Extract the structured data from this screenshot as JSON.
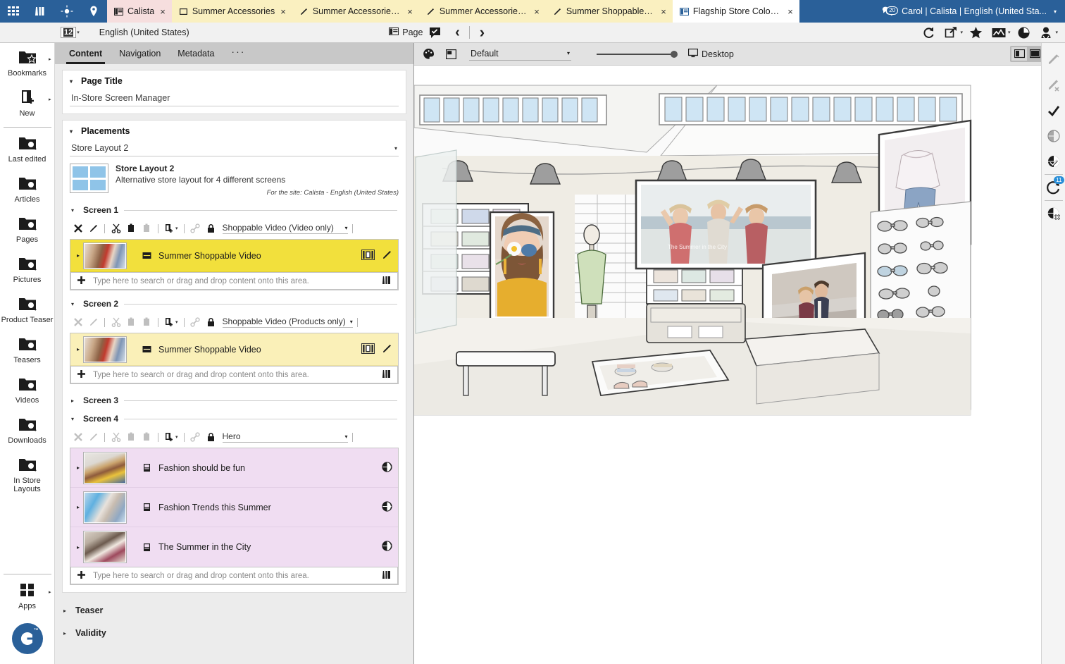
{
  "topbar": {
    "apps_icon": "grid-apps-icon",
    "library_icon": "library-icon",
    "target_icon": "target-icon",
    "location_icon": "location-pin-icon",
    "tabs": [
      {
        "label": "Calista",
        "icon": "site-icon",
        "color": "pink",
        "close": "×"
      },
      {
        "label": "Summer Accessories",
        "icon": "page-icon",
        "color": "yellow",
        "close": "×"
      },
      {
        "label": "Summer Accessories Im...",
        "icon": "edit-icon",
        "color": "yellow",
        "close": "×"
      },
      {
        "label": "Summer Accessories Im...",
        "icon": "edit-icon",
        "color": "yellow",
        "close": "×"
      },
      {
        "label": "Summer Shoppable Video",
        "icon": "edit-icon",
        "color": "yellow",
        "close": "×"
      },
      {
        "label": "Flagship Store Cologne -...",
        "icon": "site-icon",
        "color": "white",
        "close": "×"
      }
    ],
    "notification_icon": "notifications-icon",
    "notification_count": "20",
    "user": "Carol | Calista | English (United Sta...",
    "user_caret": "▾"
  },
  "toolbar2": {
    "page_number": "12",
    "page_number_caret": "▾",
    "language": "English (United States)",
    "page_button_label": "Page",
    "page_button_icon": "page-icon",
    "approve_icon": "approved-comment-icon",
    "prev_icon": "‹",
    "next_icon": "›",
    "reload_icon": "reload-icon",
    "open_in_new_icon": "open-in-new-icon",
    "favorite_icon": "star-icon",
    "image_icon": "image-icon",
    "timing_icon": "time-icon",
    "user_icon": "user-icon"
  },
  "leftrail": {
    "items": [
      {
        "label": "Bookmarks",
        "icon": "folder-star-icon",
        "arrow": "▸"
      },
      {
        "label": "New",
        "icon": "new-document-icon",
        "arrow": "▸"
      },
      {
        "label": "Last edited",
        "icon": "folder-search-icon"
      },
      {
        "label": "Articles",
        "icon": "folder-search-icon"
      },
      {
        "label": "Pages",
        "icon": "folder-search-icon"
      },
      {
        "label": "Pictures",
        "icon": "folder-search-icon"
      },
      {
        "label": "Product Teaser",
        "icon": "folder-search-icon"
      },
      {
        "label": "Teasers",
        "icon": "folder-search-icon"
      },
      {
        "label": "Videos",
        "icon": "folder-search-icon"
      },
      {
        "label": "Downloads",
        "icon": "folder-search-icon"
      },
      {
        "label": "In Store Layouts",
        "icon": "folder-search-icon"
      }
    ],
    "apps": {
      "label": "Apps",
      "icon": "apps-grid-icon",
      "arrow": "▸"
    },
    "logo": {
      "name": "coremedia-logo",
      "text": "C",
      "tm": "™"
    }
  },
  "form": {
    "tabs": [
      {
        "label": "Content",
        "active": true
      },
      {
        "label": "Navigation",
        "active": false
      },
      {
        "label": "Metadata",
        "active": false
      },
      {
        "label": "···",
        "active": false
      }
    ],
    "page_title": {
      "section_label": "Page Title",
      "tri": "▾",
      "value": "In-Store Screen Manager"
    },
    "placements": {
      "section_label": "Placements",
      "tri": "▾",
      "selected": "Store Layout 2",
      "caret": "▾",
      "layout_name": "Store Layout 2",
      "layout_desc": "Alternative store layout for 4 different screens",
      "site_note": "For the site: Calista - English (United States)"
    },
    "screens": [
      {
        "label": "Screen 1",
        "tri": "▾",
        "expanded": true,
        "toolbar_enabled": true,
        "type": "Shoppable Video (Video only)",
        "type_caret": "▾",
        "lock_icon": "lock-icon",
        "link_icon": "link-icon",
        "rows": [
          {
            "name": "Summer Shoppable Video",
            "icon": "video-content-icon",
            "highlight": "yel",
            "expand": "▸",
            "thumb": "woman-yellow-top",
            "actions": [
              "filmstrip-icon",
              "edit-pencil-icon"
            ]
          }
        ],
        "dropzone": "Type here to search or drag and drop content onto this area."
      },
      {
        "label": "Screen 2",
        "tri": "▾",
        "expanded": true,
        "toolbar_enabled": false,
        "type": "Shoppable Video (Products only)",
        "type_caret": "▾",
        "lock_icon": "lock-icon",
        "link_icon": "link-icon",
        "rows": [
          {
            "name": "Summer Shoppable Video",
            "icon": "video-content-icon",
            "highlight": "yel2",
            "expand": "▸",
            "thumb": "woman-yellow-top",
            "actions": [
              "filmstrip-icon",
              "edit-pencil-icon"
            ]
          }
        ],
        "dropzone": "Type here to search or drag and drop content onto this area."
      },
      {
        "label": "Screen 3",
        "tri": "▸",
        "expanded": false
      },
      {
        "label": "Screen 4",
        "tri": "▾",
        "expanded": true,
        "toolbar_enabled": false,
        "type": "Hero",
        "type_caret": "▾",
        "lock_icon": "lock-icon",
        "link_icon": "link-icon",
        "rows": [
          {
            "name": "Fashion should be fun",
            "icon": "teaser-content-icon",
            "highlight": "pur",
            "expand": "▸",
            "thumb": "woman-sunglasses",
            "actions": [
              "globe-icon"
            ]
          },
          {
            "name": "Fashion Trends this Summer",
            "icon": "teaser-content-icon",
            "highlight": "pur",
            "expand": "▸",
            "thumb": "couple-blue",
            "actions": [
              "globe-icon"
            ]
          },
          {
            "name": "The Summer in the City",
            "icon": "teaser-content-icon",
            "highlight": "pur",
            "expand": "▸",
            "thumb": "woman-city",
            "actions": [
              "globe-icon"
            ]
          }
        ],
        "dropzone": "Type here to search or drag and drop content onto this area."
      }
    ],
    "collapsed_sections": [
      {
        "label": "Teaser",
        "tri": "▸"
      },
      {
        "label": "Validity",
        "tri": "▸"
      }
    ],
    "mini_toolbar_icons": [
      "remove-icon",
      "edit-icon",
      "cut-icon",
      "copy-icon",
      "paste-icon",
      "insert-content-icon",
      "insert-caret-icon",
      "link-chain-icon"
    ]
  },
  "preview": {
    "palette_icon": "palette-icon",
    "frame_icon": "frame-icon",
    "variant": "Default",
    "variant_caret": "▾",
    "zoom_value": "100",
    "device_label": "Desktop",
    "device_icon": "monitor-icon",
    "view_split_icon": "split-view-icon",
    "view_single_icon": "single-view-icon",
    "view_caret": "▾"
  },
  "rightrail": {
    "items": [
      {
        "icon": "annotate-icon",
        "dim": true,
        "badge": null
      },
      {
        "icon": "annotate-off-icon",
        "dim": true,
        "badge": null
      },
      {
        "icon": "checkmark-icon",
        "dim": false,
        "badge": null
      },
      {
        "icon": "globe-grey-icon",
        "dim": false,
        "badge": null
      },
      {
        "icon": "globe-check-icon",
        "dim": false,
        "badge": null
      },
      {
        "icon": "translation-icon",
        "dim": false,
        "badge": "11"
      },
      {
        "icon": "globe-x-icon",
        "dim": false,
        "badge": null
      }
    ]
  },
  "colors": {
    "brand_blue": "#2a6099",
    "tab_pink": "#f6dede",
    "tab_yellow": "#faf0c0",
    "row_yellow": "#f2e03c",
    "row_yellow_light": "#faf0b8",
    "row_purple": "#f0ddf2",
    "layout_blue": "#8fc4e8"
  }
}
